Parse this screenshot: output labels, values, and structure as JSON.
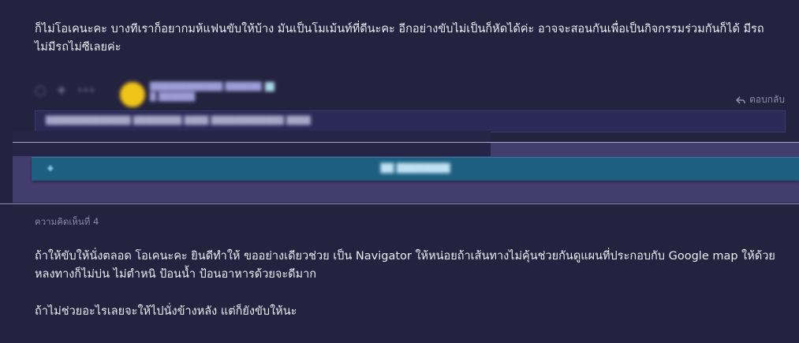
{
  "previous_comment": {
    "text": "ก็ไม่โอเคนะคะ บางทีเราก็อยากมห้แฟนขับให้บ้าง มันเป็นโมเม้นท์ที่ดีนะคะ อีกอย่างขับไม่เป็นก็หัดได้ค่ะ อาจจะสอนกันเพื่อเป็นกิจกรรมร่วมกันก็ได้ มีรถไม่มีรถไม่ซีเลยค่ะ"
  },
  "reply": {
    "reply_label": "ตอบกลับ",
    "reply_icon": "reply-arrow-icon",
    "avatar_color": "#f0c419"
  },
  "promo": {
    "banner_color": "#1e5f81"
  },
  "comment": {
    "number_label": "ความคิดเห็นที่ 4",
    "paragraph_1": "ถ้าให้ขับให้นั่งตลอด  โอเคนะคะ ยินดีทำให้ ขออย่างเดียวช่วย เป็น Navigator ให้หน่อยถ้าเส้นทางไม่คุ้นช่วยกันดูแผนที่ประกอบกับ Google map ให้ด้วย  หลงทางก็ไม่บ่น ไม่ตำหนิ  ป้อนน้ำ ป้อนอาหารด้วยจะดีมาก",
    "paragraph_2": "ถ้าไม่ช่วยอะไรเลยจะให้ไปนั่งข้างหลัง  แต่ก็ยังขับให้นะ"
  },
  "colors": {
    "background": "#24233f",
    "text": "#ededf3",
    "muted": "#8a8aa3"
  }
}
